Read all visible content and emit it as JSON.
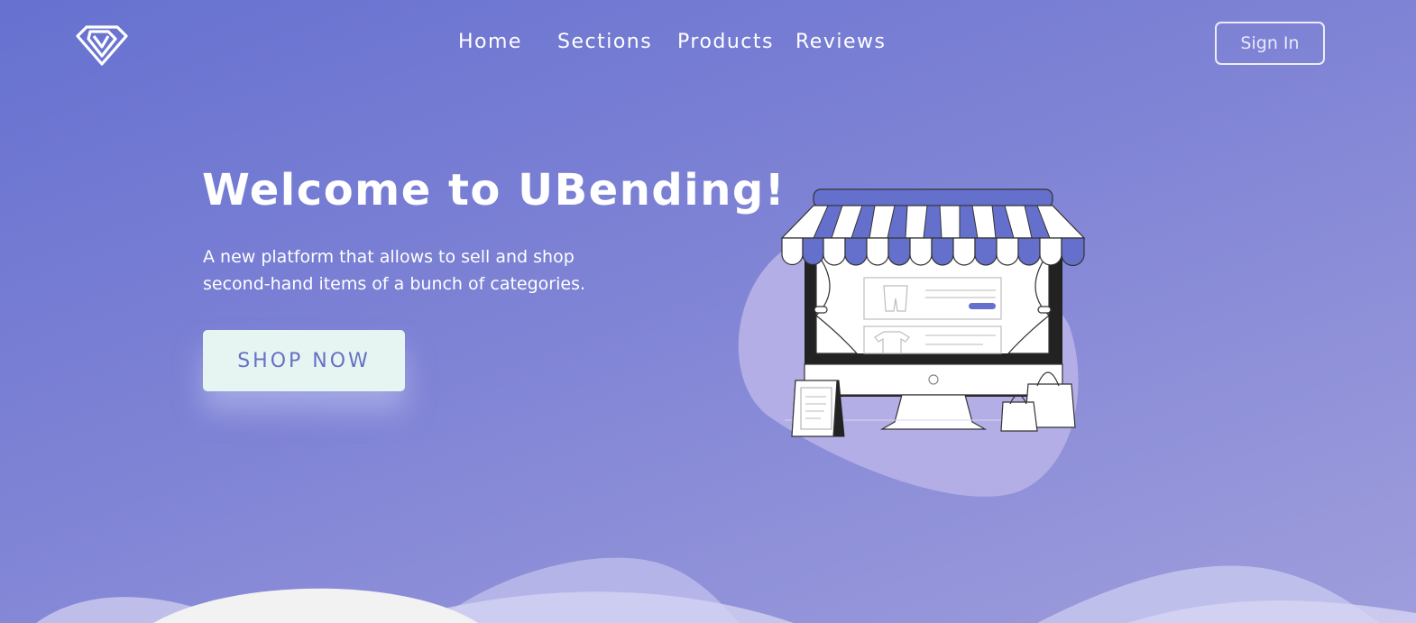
{
  "header": {
    "logo_icon": "diamond-icon",
    "nav": [
      {
        "label": "Home"
      },
      {
        "label": "Sections"
      },
      {
        "label": "Products"
      },
      {
        "label": "Reviews"
      }
    ],
    "signin_label": "Sign In"
  },
  "hero": {
    "title": "Welcome to UBending!",
    "subtitle_line1": "A new platform that allows to sell and shop",
    "subtitle_line2": "second-hand items of a bunch of categories.",
    "cta_label": "SHOP NOW",
    "illustration_icon": "storefront-icon"
  },
  "colors": {
    "accent": "#6470cc",
    "cta_background": "#e6f5f2",
    "text_light": "#ffffff"
  }
}
